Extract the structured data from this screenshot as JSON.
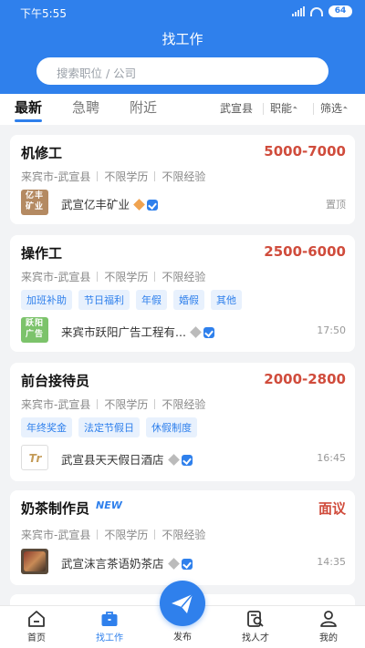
{
  "status_bar": {
    "time": "下午5:55",
    "battery": "64"
  },
  "header": {
    "title": "找工作"
  },
  "search": {
    "placeholder": "搜索职位 / 公司"
  },
  "tabs": [
    {
      "label": "最新",
      "active": true
    },
    {
      "label": "急聘",
      "active": false
    },
    {
      "label": "附近",
      "active": false
    }
  ],
  "filters": [
    {
      "label": "武宣县"
    },
    {
      "label": "职能"
    },
    {
      "label": "筛选"
    }
  ],
  "jobs": [
    {
      "title": "机修工",
      "salary": "5000-7000",
      "location": "来宾市-武宣县",
      "education": "不限学历",
      "experience": "不限经验",
      "tags": [],
      "logo_text": "亿丰矿业",
      "company": "武宣亿丰矿业",
      "member_icon": "gold-diamond-icon",
      "right_note": "置顶"
    },
    {
      "title": "操作工",
      "salary": "2500-6000",
      "location": "来宾市-武宣县",
      "education": "不限学历",
      "experience": "不限经验",
      "tags": [
        "加班补助",
        "节日福利",
        "年假",
        "婚假",
        "其他"
      ],
      "logo_text": "跃阳广告",
      "company": "来宾市跃阳广告工程有...",
      "member_icon": "gray-diamond-icon",
      "right_note": "17:50"
    },
    {
      "title": "前台接待员",
      "salary": "2000-2800",
      "location": "来宾市-武宣县",
      "education": "不限学历",
      "experience": "不限经验",
      "tags": [
        "年终奖金",
        "法定节假日",
        "休假制度"
      ],
      "logo_text": "Tr",
      "company": "武宣县天天假日酒店",
      "member_icon": "gray-diamond-icon",
      "right_note": "16:45"
    },
    {
      "title": "奶茶制作员",
      "badge": "NEW",
      "salary": "面议",
      "location": "来宾市-武宣县",
      "education": "不限学历",
      "experience": "不限经验",
      "tags": [],
      "company": "武宣沫言茶语奶茶店",
      "member_icon": "gray-diamond-icon",
      "right_note": "14:35"
    }
  ],
  "bottom_nav": [
    {
      "label": "首页",
      "icon": "home-icon"
    },
    {
      "label": "找工作",
      "icon": "briefcase-icon",
      "active": true
    },
    {
      "label": "发布",
      "icon": "paper-plane-icon"
    },
    {
      "label": "找人才",
      "icon": "find-talent-icon"
    },
    {
      "label": "我的",
      "icon": "profile-icon"
    }
  ],
  "colors": {
    "primary": "#2f80ec",
    "salary": "#d04c3c",
    "background": "#f2f3f5"
  }
}
